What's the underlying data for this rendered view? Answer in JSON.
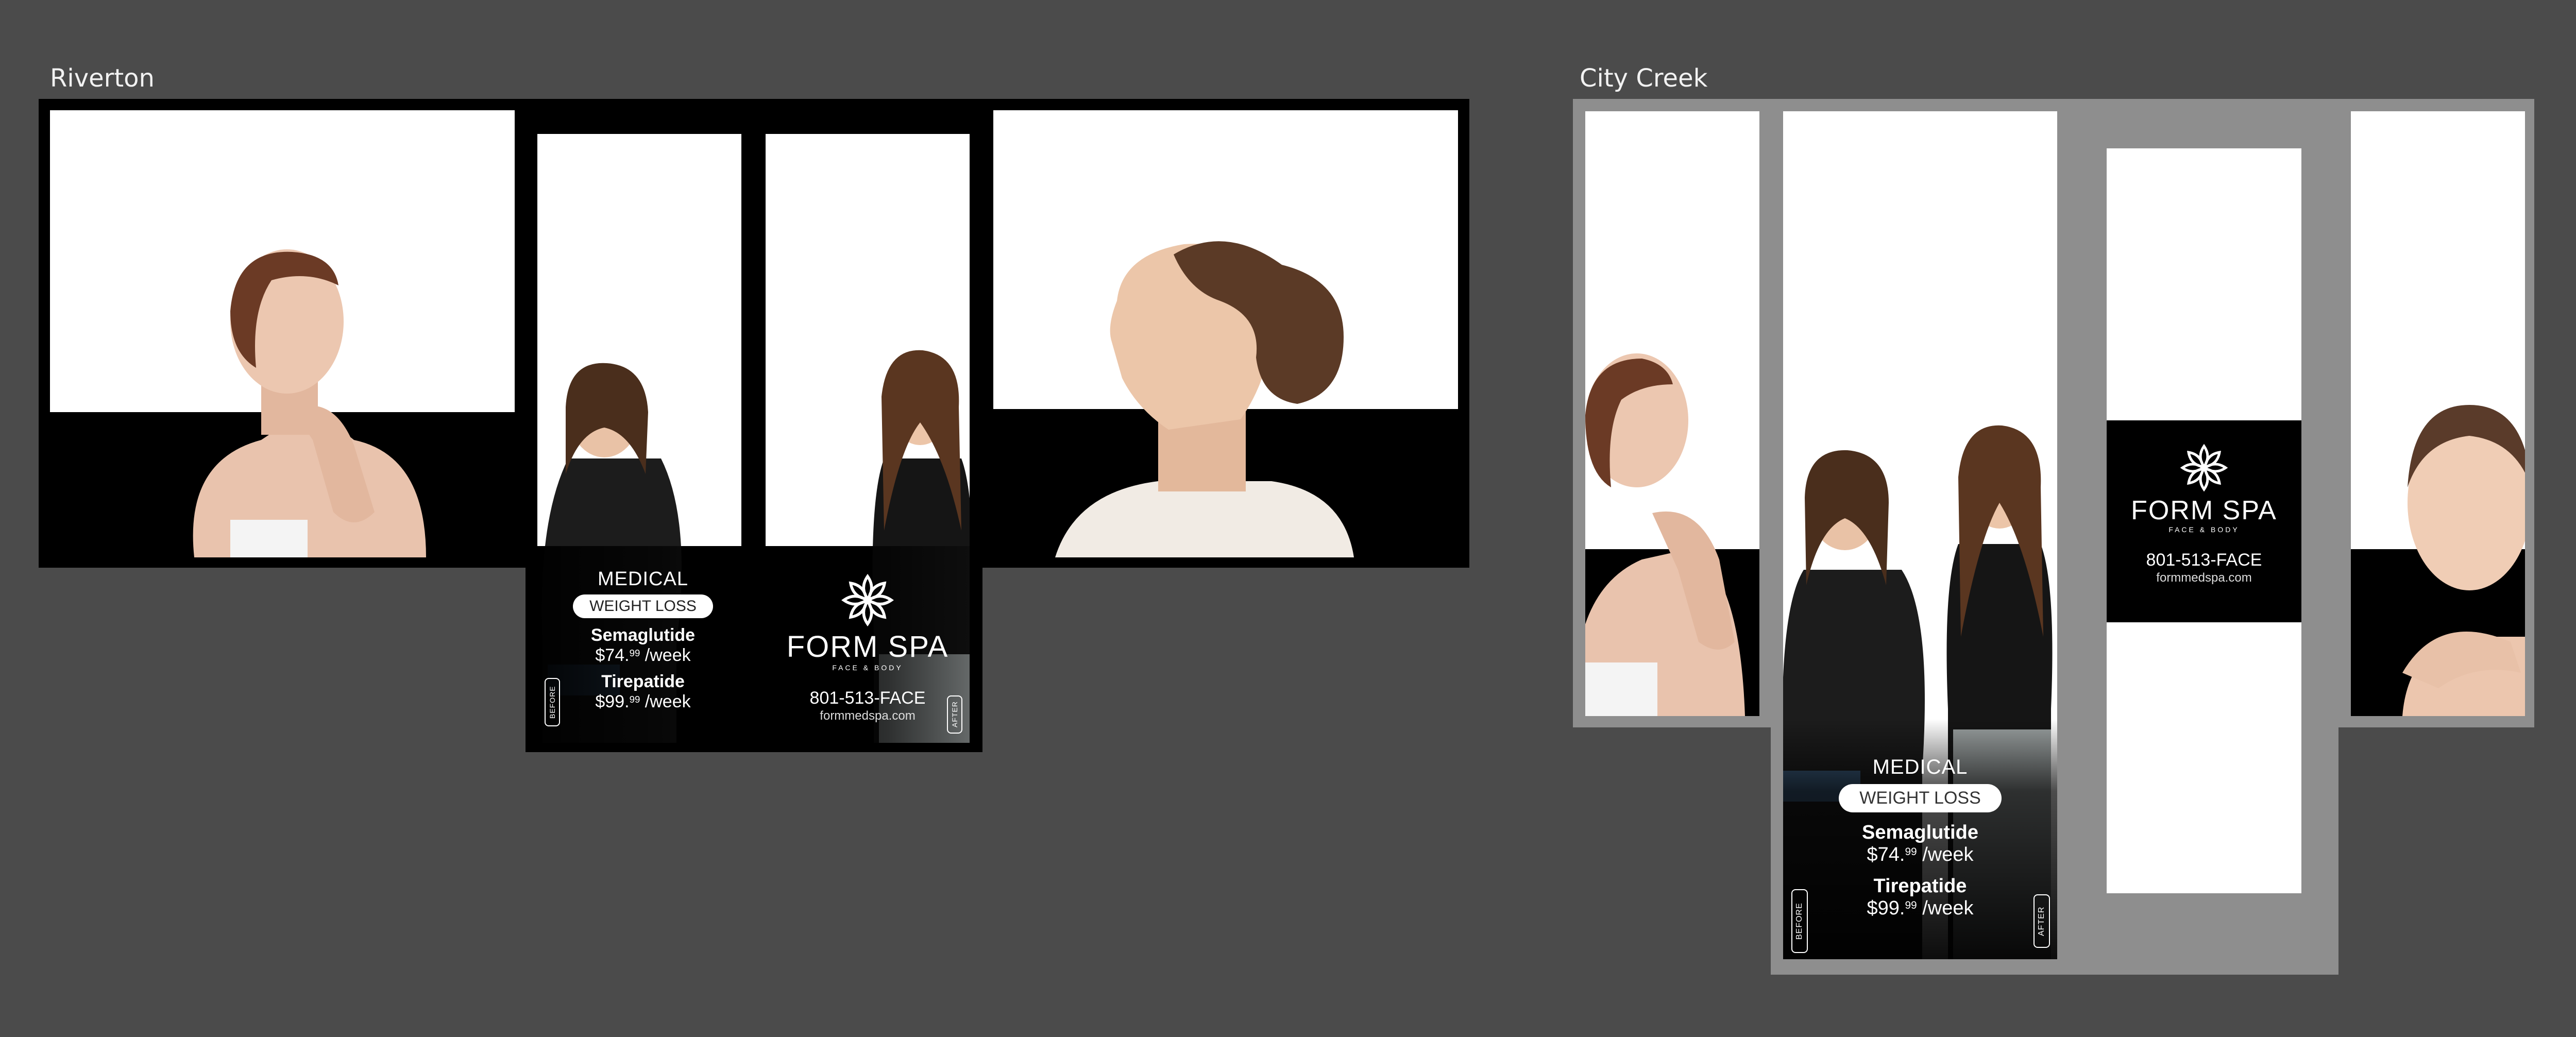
{
  "frames": {
    "riverton_title": "Riverton",
    "city_creek_title": "City Creek"
  },
  "promo": {
    "category": "MEDICAL",
    "service": "WEIGHT LOSS",
    "drug1": "Semaglutide",
    "price1_main": "$74.",
    "price1_cents": "99",
    "price1_unit": " /week",
    "drug2": "Tirepatide",
    "price2_main": "$99.",
    "price2_cents": "99",
    "price2_unit": " /week",
    "before_label": "BEFORE",
    "after_label": "AFTER"
  },
  "brand": {
    "name": "FORM SPA",
    "tagline": "FACE & BODY",
    "phone": "801-513-FACE",
    "website": "formmedspa.com"
  },
  "colors": {
    "canvas": "#4b4b4b",
    "riverton_frame": "#000000",
    "city_creek_frame": "#8e8e8e",
    "text": "#ffffff"
  }
}
